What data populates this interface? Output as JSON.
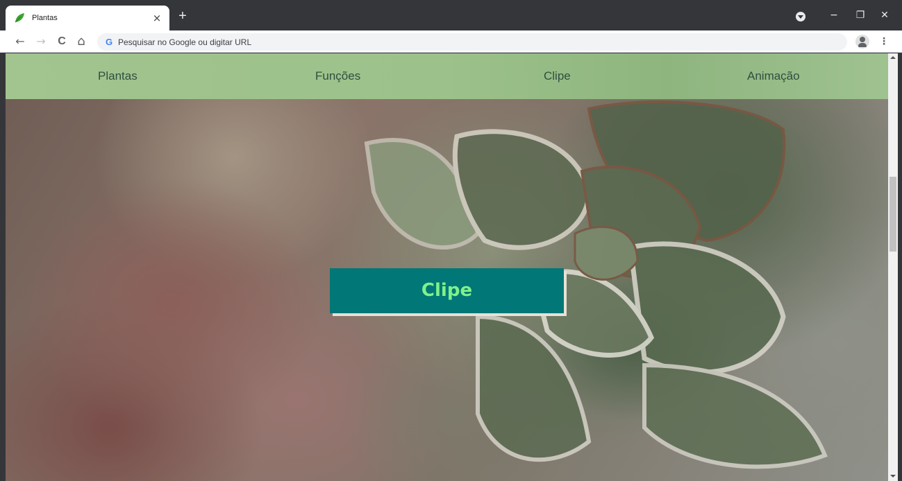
{
  "browser": {
    "tab": {
      "title": "Plantas",
      "close_glyph": "×",
      "favicon": "leaf-icon",
      "favicon_color": "#3fa535"
    },
    "new_tab_glyph": "+",
    "window_controls": {
      "minimize": "−",
      "restore": "❐",
      "close": "✕"
    },
    "toolbar": {
      "back_glyph": "←",
      "forward_glyph": "→",
      "reload_glyph": "C",
      "home_glyph": "⌂",
      "search_engine_glyph": "G",
      "omnibox_placeholder": "Pesquisar no Google ou digitar URL",
      "menu_glyph": "⋮"
    }
  },
  "page": {
    "nav": {
      "items": [
        {
          "label": "Plantas"
        },
        {
          "label": "Funções"
        },
        {
          "label": "Clipe"
        },
        {
          "label": "Animação"
        }
      ],
      "text_color": "#2f4f3f",
      "background": "#9cc18a"
    },
    "hero": {
      "button_label": "Clipe",
      "button_bg": "#027777",
      "button_text_color": "#7ef28a"
    }
  }
}
